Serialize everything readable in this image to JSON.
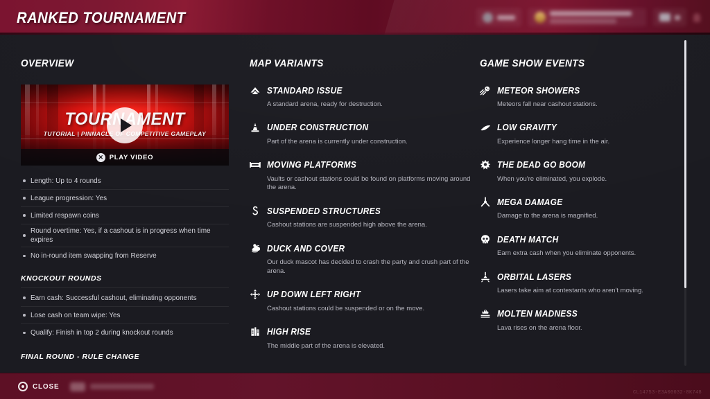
{
  "header": {
    "title": "RANKED TOURNAMENT",
    "hud": {
      "currency_label": "",
      "player_name": "",
      "level_label": ""
    }
  },
  "overview": {
    "title": "OVERVIEW",
    "video": {
      "title": "TOURNAMENT",
      "subtitle": "TUTORIAL | PINNACLE OF COMPETITIVE GAMEPLAY",
      "play_button_label": "PLAY VIDEO",
      "play_button_glyph": "✕"
    },
    "facts": [
      "Length: Up to 4 rounds",
      "League progression: Yes",
      "Limited respawn coins",
      "Round overtime: Yes, if a cashout is in progress when time expires",
      "No in-round item swapping from Reserve"
    ],
    "knockout_rounds": {
      "title": "KNOCKOUT ROUNDS",
      "facts": [
        "Earn cash: Successful cashout, eliminating opponents",
        "Lose cash on team wipe: Yes",
        "Qualify: Finish in top 2 during knockout rounds"
      ]
    },
    "final_round": {
      "title": "FINAL ROUND - RULE CHANGE"
    }
  },
  "map_variants": {
    "title": "MAP VARIANTS",
    "items": [
      {
        "icon": "mountain-icon",
        "name": "STANDARD ISSUE",
        "desc": "A standard arena, ready for destruction."
      },
      {
        "icon": "traffic-cone-icon",
        "name": "UNDER CONSTRUCTION",
        "desc": "Part of the arena is currently under construction."
      },
      {
        "icon": "platform-icon",
        "name": "MOVING PLATFORMS",
        "desc": "Vaults or cashout stations could be found on platforms moving around the arena."
      },
      {
        "icon": "hook-icon",
        "name": "SUSPENDED STRUCTURES",
        "desc": "Cashout stations are suspended high above the arena."
      },
      {
        "icon": "duck-icon",
        "name": "DUCK AND COVER",
        "desc": "Our duck mascot has decided to crash the party and crush part of the arena."
      },
      {
        "icon": "four-arrows-icon",
        "name": "UP DOWN LEFT RIGHT",
        "desc": "Cashout stations could be suspended or on the move."
      },
      {
        "icon": "skyscraper-icon",
        "name": "HIGH RISE",
        "desc": "The middle part of the arena is elevated."
      }
    ]
  },
  "game_show_events": {
    "title": "GAME SHOW EVENTS",
    "items": [
      {
        "icon": "comet-icon",
        "name": "METEOR SHOWERS",
        "desc": "Meteors fall near cashout stations."
      },
      {
        "icon": "feather-icon",
        "name": "LOW GRAVITY",
        "desc": "Experience longer hang time in the air."
      },
      {
        "icon": "explosion-icon",
        "name": "THE DEAD GO BOOM",
        "desc": "When you're eliminated, you explode."
      },
      {
        "icon": "impact-icon",
        "name": "MEGA DAMAGE",
        "desc": "Damage to the arena is magnified."
      },
      {
        "icon": "skull-icon",
        "name": "DEATH MATCH",
        "desc": "Earn extra cash when you eliminate opponents."
      },
      {
        "icon": "laser-beam-icon",
        "name": "ORBITAL LASERS",
        "desc": "Lasers take aim at contestants who aren't moving."
      },
      {
        "icon": "lava-icon",
        "name": "MOLTEN MADNESS",
        "desc": "Lava rises on the arena floor."
      }
    ]
  },
  "footer": {
    "close_label": "CLOSE",
    "secondary_label": "",
    "build_id": "CL14753-E3A00032-8K748"
  },
  "colors": {
    "header_red": "#7b1430",
    "footer_red": "#5d1025",
    "panel_dark": "#1b1b21",
    "text_primary": "#ffffff",
    "text_secondary": "#b6b6bf",
    "accent_video_red": "#d51410"
  }
}
